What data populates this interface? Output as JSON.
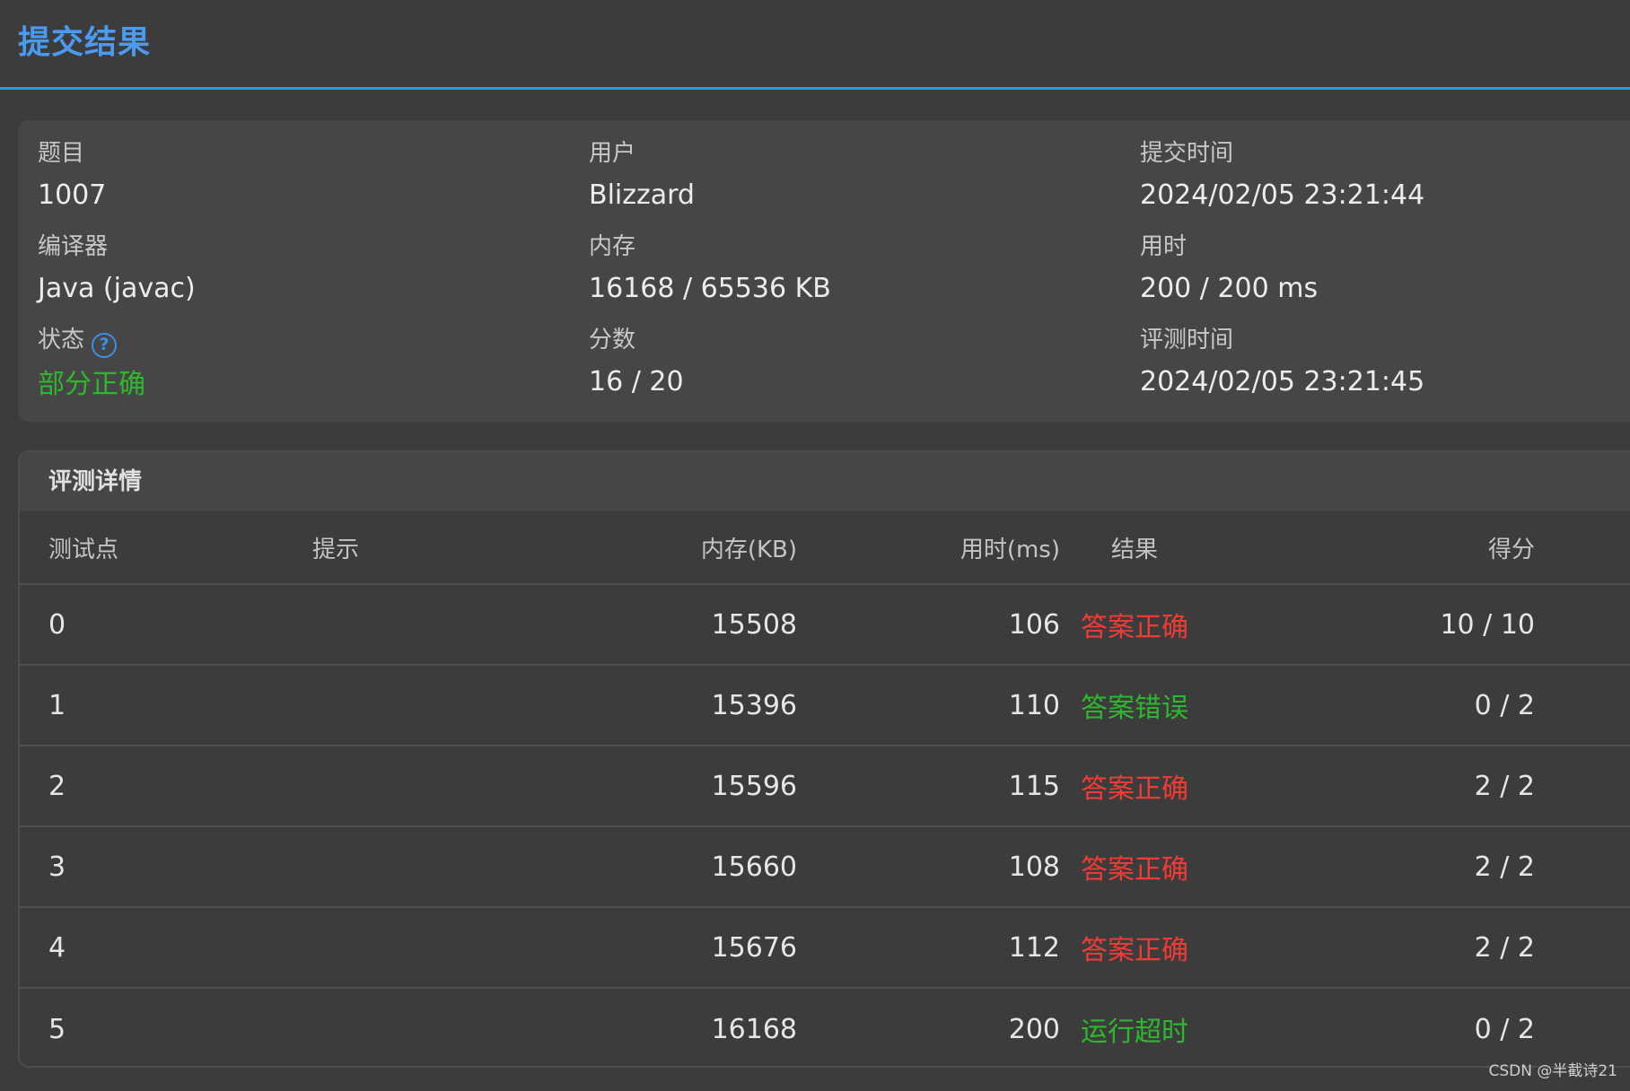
{
  "header": {
    "title": "提交结果"
  },
  "info": {
    "problem_label": "题目",
    "problem_value": "1007",
    "user_label": "用户",
    "user_value": "Blizzard",
    "submit_time_label": "提交时间",
    "submit_time_value": "2024/02/05 23:21:44",
    "compiler_label": "编译器",
    "compiler_value": "Java (javac)",
    "memory_label": "内存",
    "memory_value": "16168 / 65536 KB",
    "time_label": "用时",
    "time_value": "200 / 200 ms",
    "status_label": "状态",
    "status_value": "部分正确",
    "status_color": "#2eb82e",
    "score_label": "分数",
    "score_value": "16 / 20",
    "judge_time_label": "评测时间",
    "judge_time_value": "2024/02/05 23:21:45"
  },
  "details": {
    "title": "评测详情",
    "columns": {
      "id": "测试点",
      "hint": "提示",
      "memory": "内存(KB)",
      "time": "用时(ms)",
      "result": "结果",
      "score": "得分"
    },
    "rows": [
      {
        "id": "0",
        "hint": "",
        "memory": "15508",
        "time": "106",
        "result": "答案正确",
        "result_color": "red",
        "score": "10 / 10"
      },
      {
        "id": "1",
        "hint": "",
        "memory": "15396",
        "time": "110",
        "result": "答案错误",
        "result_color": "green",
        "score": "0 / 2"
      },
      {
        "id": "2",
        "hint": "",
        "memory": "15596",
        "time": "115",
        "result": "答案正确",
        "result_color": "red",
        "score": "2 / 2"
      },
      {
        "id": "3",
        "hint": "",
        "memory": "15660",
        "time": "108",
        "result": "答案正确",
        "result_color": "red",
        "score": "2 / 2"
      },
      {
        "id": "4",
        "hint": "",
        "memory": "15676",
        "time": "112",
        "result": "答案正确",
        "result_color": "red",
        "score": "2 / 2"
      },
      {
        "id": "5",
        "hint": "",
        "memory": "16168",
        "time": "200",
        "result": "运行超时",
        "result_color": "green",
        "score": "0 / 2"
      }
    ]
  },
  "watermark": "CSDN @半截诗21"
}
